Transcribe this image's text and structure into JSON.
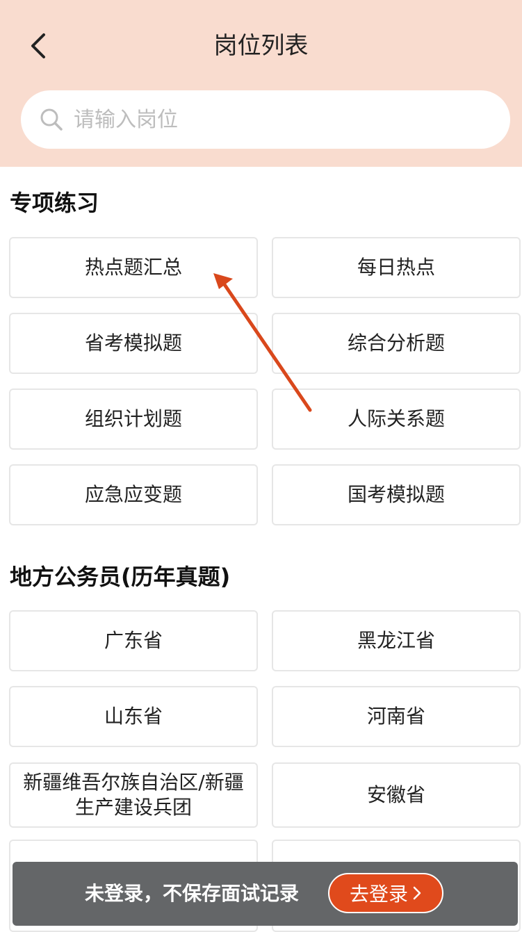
{
  "header": {
    "title": "岗位列表",
    "back_icon": "chevron-left-icon",
    "background_color": "#f9dccf"
  },
  "search": {
    "placeholder": "请输入岗位",
    "value": "",
    "icon": "search-icon"
  },
  "special_practice": {
    "title": "专项练习",
    "items": [
      "热点题汇总",
      "每日热点",
      "省考模拟题",
      "综合分析题",
      "组织计划题",
      "人际关系题",
      "应急应变题",
      "国考模拟题"
    ]
  },
  "local_civil_servant": {
    "title": "地方公务员(历年真题)",
    "items": [
      "广东省",
      "黑龙江省",
      "山东省",
      "河南省",
      "新疆维吾尔族自治区/新疆生产建设兵团",
      "安徽省"
    ]
  },
  "login_banner": {
    "message": "未登录，不保存面试记录",
    "button_label": "去登录",
    "button_icon": "chevron-right-icon",
    "button_color": "#e04a1c",
    "banner_color": "#646668"
  },
  "annotation": {
    "arrow_color": "#d9481c"
  }
}
